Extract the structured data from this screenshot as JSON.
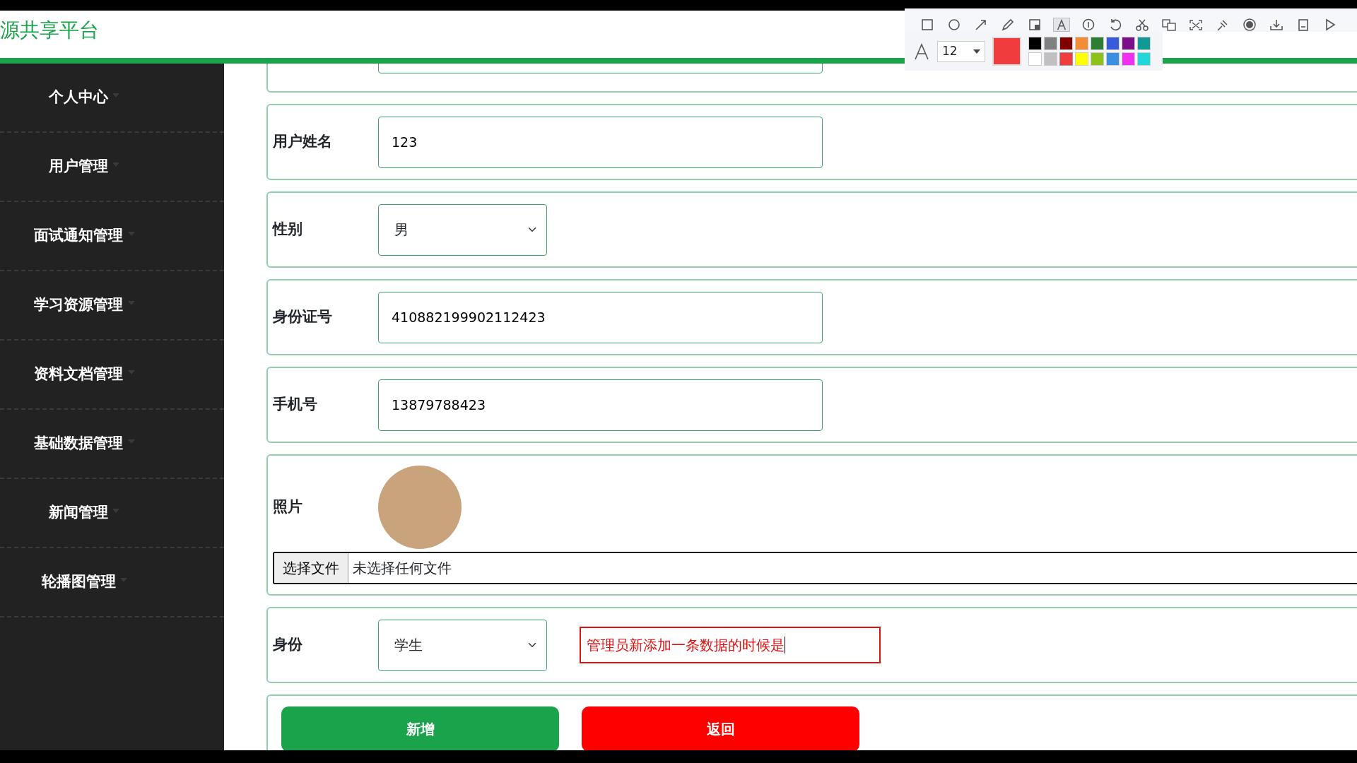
{
  "header": {
    "title": "源共享平台"
  },
  "sidebar": {
    "items": [
      {
        "label": "个人中心"
      },
      {
        "label": "用户管理"
      },
      {
        "label": "面试通知管理"
      },
      {
        "label": "学习资源管理"
      },
      {
        "label": "资料文档管理"
      },
      {
        "label": "基础数据管理"
      },
      {
        "label": "新闻管理"
      },
      {
        "label": "轮播图管理"
      }
    ]
  },
  "form": {
    "rows": [
      {
        "kind": "input"
      },
      {
        "kind": "input",
        "label": "用户姓名",
        "value": "123"
      },
      {
        "kind": "select",
        "label": "性别",
        "value": "男"
      },
      {
        "kind": "input",
        "label": "身份证号",
        "value": "410882199902112423"
      },
      {
        "kind": "input",
        "label": "手机号",
        "value": "13879788423"
      },
      {
        "kind": "photo",
        "label": "照片",
        "file_button": "选择文件",
        "file_status": "未选择任何文件"
      },
      {
        "kind": "select",
        "label": "身份",
        "value": "学生",
        "annotation": "管理员新添加一条数据的时候是"
      }
    ],
    "buttons": [
      {
        "kind": "primary",
        "label": "新增"
      },
      {
        "kind": "danger",
        "label": "返回"
      }
    ]
  },
  "screenshot_tool": {
    "tools": [
      {
        "kind": "rectangle",
        "selected": false
      },
      {
        "kind": "circle",
        "selected": false
      },
      {
        "kind": "arrow",
        "selected": false
      },
      {
        "kind": "pencil",
        "selected": false
      },
      {
        "kind": "mosaic",
        "selected": false
      },
      {
        "kind": "text",
        "selected": true
      },
      {
        "kind": "number",
        "selected": false
      },
      {
        "kind": "undo",
        "selected": false
      },
      {
        "kind": "scissors",
        "selected": false
      },
      {
        "kind": "translate",
        "selected": false
      },
      {
        "kind": "expand",
        "selected": false
      },
      {
        "kind": "pin",
        "selected": false
      },
      {
        "kind": "record",
        "selected": false
      },
      {
        "kind": "download",
        "selected": false
      },
      {
        "kind": "save",
        "selected": false
      },
      {
        "kind": "play",
        "selected": false
      }
    ],
    "font_size": "12",
    "palette": [
      {
        "color": "#000000",
        "selected": false
      },
      {
        "color": "#808080",
        "selected": false
      },
      {
        "color": "#800000",
        "selected": false
      },
      {
        "color": "#f28c38",
        "selected": false
      },
      {
        "color": "#2e7d32",
        "selected": false
      },
      {
        "color": "#3a5bd9",
        "selected": false
      },
      {
        "color": "#7b0f8a",
        "selected": false
      },
      {
        "color": "#109a96",
        "selected": false
      },
      {
        "color": "#ffffff",
        "selected": false
      },
      {
        "color": "#c0c0c0",
        "selected": false
      },
      {
        "color": "#f03c3c",
        "selected": true
      },
      {
        "color": "#ffff00",
        "selected": false
      },
      {
        "color": "#8cc21a",
        "selected": false
      },
      {
        "color": "#3a8fe0",
        "selected": false
      },
      {
        "color": "#f030f0",
        "selected": false
      },
      {
        "color": "#20d8d8",
        "selected": false
      }
    ]
  }
}
